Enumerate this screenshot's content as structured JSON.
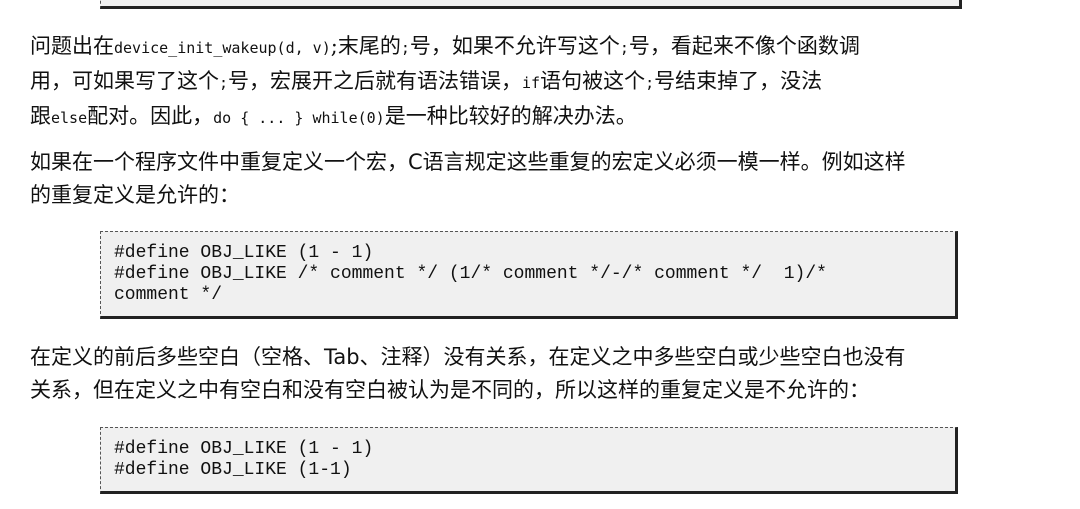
{
  "paragraphs": {
    "p1": {
      "t1": "问题出在",
      "c1": "device_init_wakeup(d, v)",
      "t2": ";末尾的",
      "c2": ";",
      "t3": "号，如果不允许写这个",
      "c3": ";",
      "t4": "号，看起来不像个函数调",
      "t5": "用，可如果写了这个",
      "c4": ";",
      "t6": "号，宏展开之后就有语法错误，",
      "c5": "if",
      "t7": "语句被这个",
      "c6": ";",
      "t8": "号结束掉了，没法",
      "t9": "跟",
      "c7": "else",
      "t10": "配对。因此，",
      "c8": "do { ... } while(0)",
      "t11": "是一种比较好的解决办法。"
    },
    "p2": {
      "line1_a": "如果在一个程序文件中重复定义一个宏，",
      "line1_b": "C",
      "line1_c": "语言规定这些重复的宏定义必须一模一样。例如这样",
      "line2": "的重复定义是允许的："
    },
    "p3": {
      "line1_a": "在定义的前后多些空白（空格、",
      "line1_b": "Tab",
      "line1_c": "、注释）没有关系，在定义之中多些空白或少些空白也没有",
      "line2": "关系，但在定义之中有空白和没有空白被认为是不同的，所以这样的重复定义是不允许的："
    }
  },
  "code_blocks": [
    {
      "text": "#define OBJ_LIKE (1 - 1)\n#define OBJ_LIKE /* comment */ (1/* comment */-/* comment */  1)/*\ncomment */"
    },
    {
      "text": "#define OBJ_LIKE (1 - 1)\n#define OBJ_LIKE (1-1)"
    }
  ]
}
